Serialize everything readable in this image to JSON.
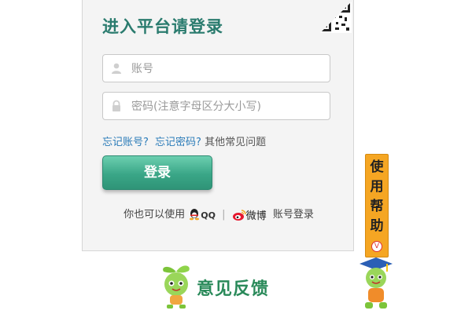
{
  "login": {
    "title": "进入平台请登录",
    "account_placeholder": "账号",
    "password_placeholder": "密码(注意字母区分大小写)",
    "forgot_account": "忘记账号?",
    "forgot_password": "忘记密码?",
    "other_issues": "其他常见问题",
    "login_button": "登录",
    "alt_prefix": "你也可以使用",
    "qq_label": "QQ",
    "separator": "|",
    "weibo_label": "微博",
    "alt_suffix": "账号登录"
  },
  "feedback": {
    "label": "意见反馈"
  },
  "help": {
    "label": "使用帮助",
    "toggle": "V"
  },
  "colors": {
    "title": "#2a7b6e",
    "link": "#2a7bb8",
    "button": "#3aa687",
    "help_tab": "#f5a623",
    "feedback": "#2a8a5a"
  }
}
